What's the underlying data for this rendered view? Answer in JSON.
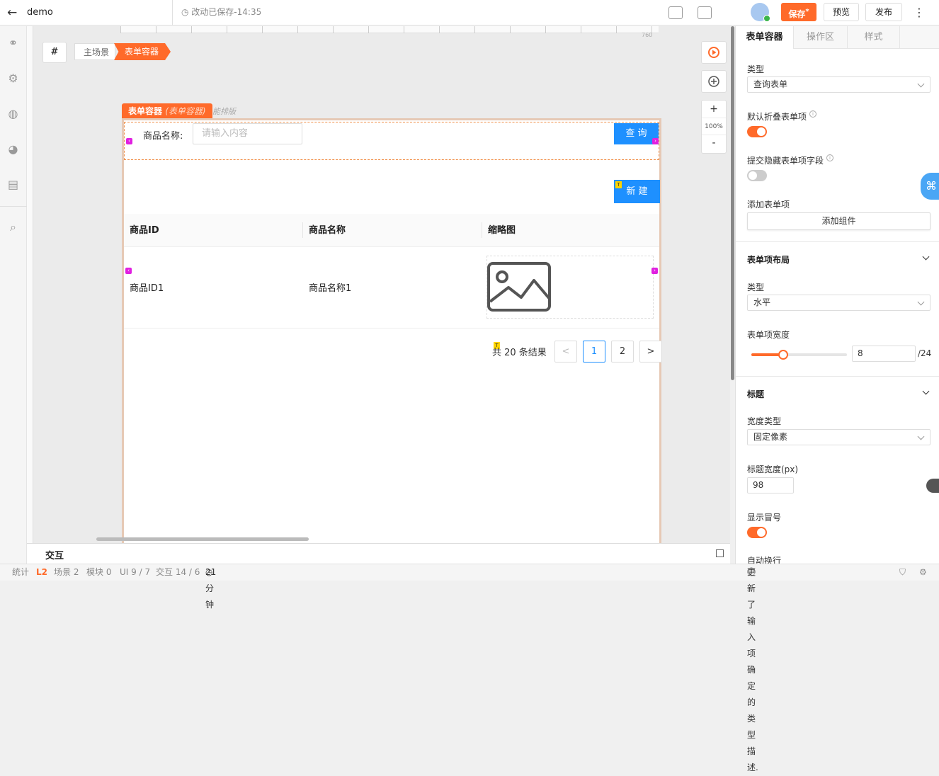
{
  "topbar": {
    "app_name": "demo",
    "save_status": "改动已保存-14:35",
    "save_label": "保存",
    "save_mark": "*",
    "preview_label": "预览",
    "publish_label": "发布",
    "more_label": "⋮"
  },
  "canvas": {
    "hash_label": "#",
    "ruler_mark": "760",
    "breadcrumb": [
      "主场景",
      "表单容器"
    ],
    "zoom": {
      "plus": "+",
      "level": "100%",
      "minus": "-"
    }
  },
  "form_container": {
    "tag_name": "表单容器",
    "tag_type": "(表单容器)",
    "ghost_text": "能排版",
    "query_label": "商品名称:",
    "query_placeholder": "请输入内容",
    "query_button": "查 询",
    "new_button": "新 建",
    "badge": "T",
    "table": {
      "columns": [
        "商品ID",
        "商品名称",
        "缩略图"
      ],
      "rows": [
        {
          "id": "商品ID1",
          "name": "商品名称1"
        }
      ]
    },
    "pagination": {
      "total_text": "共 20 条结果",
      "prev": "<",
      "pages": [
        "1",
        "2"
      ],
      "current": "1",
      "next": ">"
    }
  },
  "bottom_panel": {
    "title": "交互"
  },
  "statusbar": {
    "stats": "统计",
    "level": "L2",
    "scenes": "场景 2",
    "modules": "模块 0",
    "ui": "UI 9 / 7",
    "interactions": "交互 14 / 6",
    "time": "21分钟",
    "message": "更新了输入项 确定 的类型描述."
  },
  "right_panel": {
    "tabs": [
      "表单容器",
      "操作区",
      "样式"
    ],
    "active_tab": "表单容器",
    "type_label": "类型",
    "type_value": "查询表单",
    "collapse_label": "默认折叠表单项",
    "collapse_on": true,
    "hide_label": "提交隐藏表单项字段",
    "hide_on": false,
    "add_item_label": "添加表单项",
    "add_component_button": "添加组件",
    "layout_section": "表单项布局",
    "layout_type_label": "类型",
    "layout_type_value": "水平",
    "width_label": "表单项宽度",
    "width_value": "8",
    "width_fraction": 0.333,
    "width_suffix": "/24",
    "title_section": "标题",
    "width_type_label": "宽度类型",
    "width_type_value": "固定像素",
    "title_width_label": "标题宽度(px)",
    "title_width_value": "98",
    "show_colon_label": "显示冒号",
    "show_colon_on": true,
    "auto_wrap_label": "自动换行"
  },
  "colors": {
    "accent": "#ff6a2a",
    "primary": "#1e90ff",
    "handle": "#e020e0"
  },
  "icons": {
    "leftbar": [
      "link-icon",
      "settings-icon",
      "globe-icon",
      "palette-icon",
      "report-icon",
      "search-icon"
    ]
  }
}
